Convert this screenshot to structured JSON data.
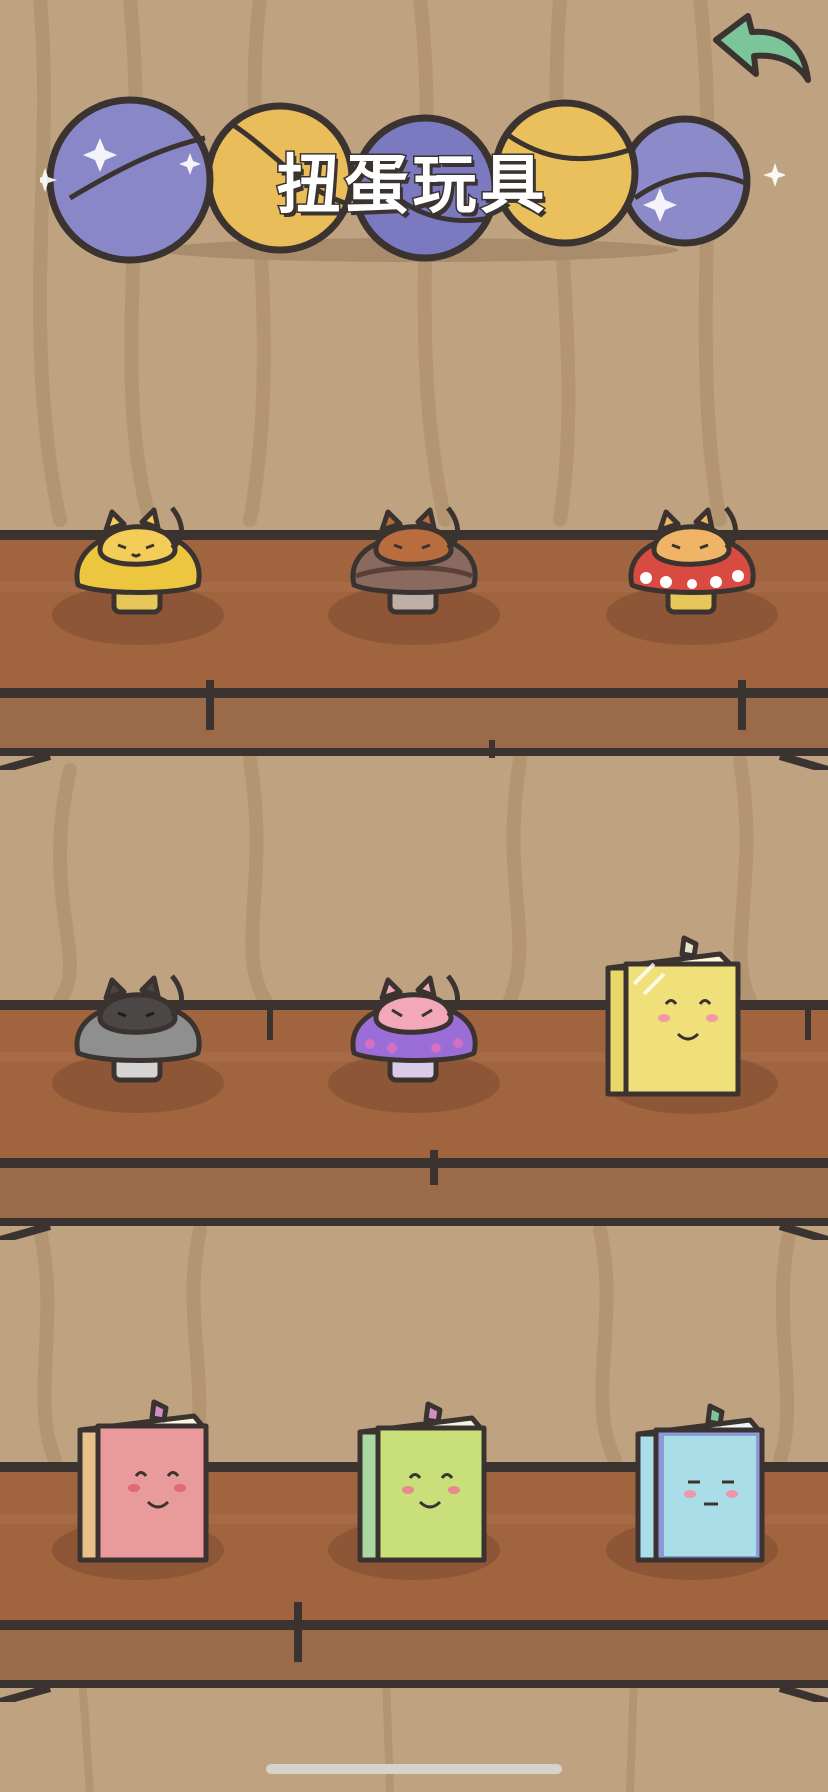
{
  "screen": {
    "title": "扭蛋玩具"
  },
  "header": {
    "back_icon": "back-arrow-icon",
    "capsule_colors": [
      "#8a87c8",
      "#e9bd5a",
      "#7b79bf",
      "#eac05c",
      "#8d8ac9"
    ]
  },
  "shelves": [
    {
      "items": [
        {
          "name": "yellow-cat-mushroom",
          "cat_color": "#f2cd57",
          "cap_color": "#edc640",
          "type": "mushroom"
        },
        {
          "name": "brown-cat-mushroom",
          "cat_color": "#b96d3e",
          "cap_color": "#8a6a5e",
          "type": "mushroom"
        },
        {
          "name": "orange-cat-red-mushroom",
          "cat_color": "#f0b466",
          "cap_color": "#d94a40",
          "type": "mushroom-dotted"
        }
      ]
    },
    {
      "items": [
        {
          "name": "black-cat-gray-mushroom",
          "cat_color": "#4b4747",
          "cap_color": "#8f8f8f",
          "type": "mushroom"
        },
        {
          "name": "pink-cat-purple-mushroom",
          "cat_color": "#f2a8b8",
          "cap_color": "#9a6ed6",
          "type": "mushroom-dotted-purple"
        },
        {
          "name": "yellow-book",
          "cover_color": "#efe07a",
          "spine_color": "#e9d76a",
          "type": "book"
        }
      ]
    },
    {
      "items": [
        {
          "name": "pink-book",
          "cover_color": "#e99a9a",
          "spine_color": "#e8c18a",
          "type": "book"
        },
        {
          "name": "green-book",
          "cover_color": "#c9e07a",
          "spine_color": "#a9d9a0",
          "type": "book"
        },
        {
          "name": "blue-book",
          "cover_color": "#a9dde8",
          "spine_color": "#8d9ad8",
          "type": "book-sleepy"
        }
      ]
    }
  ]
}
